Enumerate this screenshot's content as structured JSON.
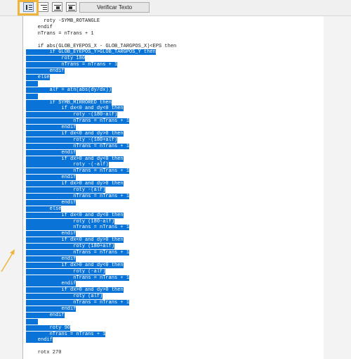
{
  "toolbar": {
    "verify_label": "Verificar Texto",
    "buttons": [
      "list-format-icon",
      "indent-right-icon",
      "block-indent-icon",
      "block-outdent-icon"
    ]
  },
  "editor": {
    "lines": [
      {
        "text": "      roty -SYMB_ROTANGLE",
        "sel": false
      },
      {
        "text": "    endif",
        "sel": false
      },
      {
        "text": "    nTrans = nTrans + 1",
        "sel": false
      },
      {
        "text": "",
        "sel": false
      },
      {
        "text": "    if abs(GLOB_EYEPOS_X - GLOB_TARGPOS_X)<EPS then",
        "sel": false
      },
      {
        "text": "        if GLOB_EYEPOS_Y>GLOB_TARGPOS_Y then",
        "sel": true
      },
      {
        "text": "            roty 180",
        "sel": true
      },
      {
        "text": "            nTrans = nTrans + 1",
        "sel": true
      },
      {
        "text": "        endif",
        "sel": true
      },
      {
        "text": "    else",
        "sel": true
      },
      {
        "text": "",
        "sel": true
      },
      {
        "text": "        alf = atn(abs(dy/dx))",
        "sel": true
      },
      {
        "text": "",
        "sel": true
      },
      {
        "text": "        if SYMB_MIRRORED then",
        "sel": true
      },
      {
        "text": "            if dx<0 and dy<0 then",
        "sel": true
      },
      {
        "text": "                roty -(180-alf)",
        "sel": true
      },
      {
        "text": "                nTrans = nTrans + 1",
        "sel": true
      },
      {
        "text": "            endif",
        "sel": true
      },
      {
        "text": "            if dx<0 and dy>0 then",
        "sel": true
      },
      {
        "text": "                roty -(180+alf)",
        "sel": true
      },
      {
        "text": "                nTrans = nTrans + 1",
        "sel": true
      },
      {
        "text": "            endif",
        "sel": true
      },
      {
        "text": "            if dx>0 and dy<0 then",
        "sel": true
      },
      {
        "text": "                roty -(-alf)",
        "sel": true
      },
      {
        "text": "                nTrans = nTrans + 1",
        "sel": true
      },
      {
        "text": "            endif",
        "sel": true
      },
      {
        "text": "            if dx>0 and dy>0 then",
        "sel": true
      },
      {
        "text": "                roty -(alf)",
        "sel": true
      },
      {
        "text": "                nTrans = nTrans + 1",
        "sel": true
      },
      {
        "text": "            endif",
        "sel": true
      },
      {
        "text": "        else",
        "sel": true
      },
      {
        "text": "            if dx<0 and dy<0 then",
        "sel": true
      },
      {
        "text": "                roty (180-alf)",
        "sel": true
      },
      {
        "text": "                nTrans = nTrans + 1",
        "sel": true
      },
      {
        "text": "            endif",
        "sel": true
      },
      {
        "text": "            if dx<0 and dy>0 then",
        "sel": true
      },
      {
        "text": "                roty (180+alf)",
        "sel": true
      },
      {
        "text": "                nTrans = nTrans + 1",
        "sel": true
      },
      {
        "text": "            endif",
        "sel": true
      },
      {
        "text": "            if dx>0 and dy<0 then",
        "sel": true
      },
      {
        "text": "                roty (-alf)",
        "sel": true
      },
      {
        "text": "                nTrans = nTrans + 1",
        "sel": true
      },
      {
        "text": "            endif",
        "sel": true
      },
      {
        "text": "            if dx>0 and dy>0 then",
        "sel": true
      },
      {
        "text": "                roty (alf)",
        "sel": true
      },
      {
        "text": "                nTrans = nTrans + 1",
        "sel": true
      },
      {
        "text": "            endif",
        "sel": true
      },
      {
        "text": "        endif",
        "sel": true
      },
      {
        "text": "",
        "sel": true
      },
      {
        "text": "        roty 90",
        "sel": true
      },
      {
        "text": "        nTrans = nTrans + 1",
        "sel": true
      },
      {
        "text": "    endif",
        "sel": true
      },
      {
        "text": "",
        "sel": false
      },
      {
        "text": "    rotx 270",
        "sel": false
      }
    ]
  },
  "colors": {
    "selection": "#0a73d8",
    "highlight_box": "#f0b43a",
    "arrow": "#f0b43a"
  }
}
